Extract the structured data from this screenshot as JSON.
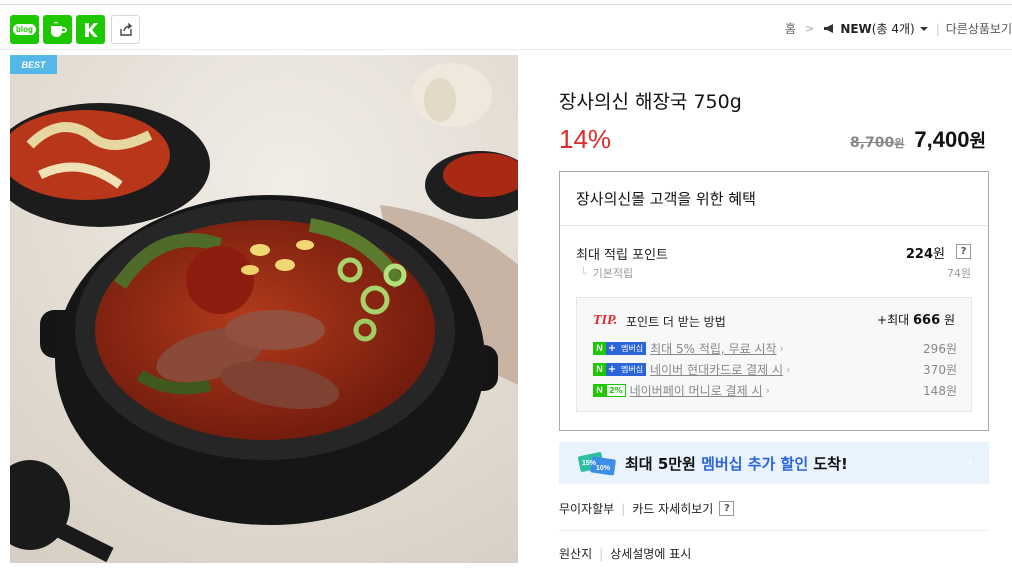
{
  "share": {
    "blog_label": "blog",
    "icons": [
      "blog-icon",
      "cafe-icon",
      "k-icon",
      "share-icon"
    ]
  },
  "breadcrumb": {
    "home": "홈",
    "separator": ">",
    "current": "NEW",
    "count": "(총 4개)",
    "other": "다른상품보기"
  },
  "product": {
    "badge": "BEST",
    "title": "장사의신 해장국 750g",
    "discount": "14%",
    "original_price": "8,700",
    "original_unit": "원",
    "sale_price": "7,400",
    "sale_unit": "원"
  },
  "benefit": {
    "title": "장사의신몰 고객을 위한 혜택",
    "max_point_label": "최대 적립 포인트",
    "max_point_value": "224",
    "max_point_unit": "원",
    "help": "?",
    "base_label": "기본적립",
    "base_value": "74원",
    "tip": {
      "label": "TIP.",
      "text": "포인트 더 받는 방법",
      "max_prefix": "+최대",
      "max_value": "666",
      "max_unit": "원",
      "rows": [
        {
          "badge": "멤버십",
          "text": "최대 5% 적립, 무료 시작",
          "value": "296원"
        },
        {
          "badge": "멤버십",
          "text": "네이버 현대카드로 결제 시",
          "value": "370원"
        },
        {
          "badge": "2%",
          "text": "네이버페이 머니로 결제 시",
          "value": "148원"
        }
      ]
    }
  },
  "banner": {
    "prefix": "최대 5만원 ",
    "highlight": "멤버십 추가 할인",
    "suffix": " 도착!",
    "icon_labels": [
      "15%",
      "10%"
    ]
  },
  "installment": {
    "label": "무이자할부",
    "card_details": "카드 자세히보기",
    "help": "?"
  },
  "origin": {
    "label": "원산지",
    "value": "상세설명에 표시"
  },
  "colors": {
    "naver_green": "#1ec800",
    "discount_red": "#e0292a",
    "membership_blue": "#2b65d9",
    "banner_bg": "#e8f3fd",
    "best_badge": "#53b7e8"
  }
}
